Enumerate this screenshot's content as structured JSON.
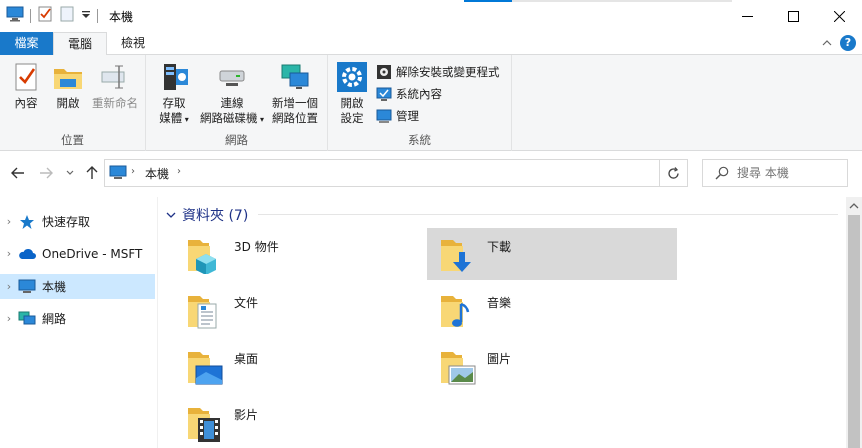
{
  "window": {
    "title": "本機"
  },
  "ribbon_tabs": {
    "file": "檔案",
    "computer": "電腦",
    "view": "檢視"
  },
  "ribbon": {
    "location": {
      "label": "位置",
      "properties": "內容",
      "open": "開啟",
      "rename": "重新命名"
    },
    "network": {
      "label": "網路",
      "access_media_1": "存取",
      "access_media_2": "媒體",
      "map_drive_1": "連線",
      "map_drive_2": "網路磁碟機",
      "add_location_1": "新增一個",
      "add_location_2": "網路位置"
    },
    "system": {
      "label": "系統",
      "open_settings_1": "開啟",
      "open_settings_2": "設定",
      "uninstall": "解除安裝或變更程式",
      "system_properties": "系統內容",
      "manage": "管理"
    }
  },
  "address": {
    "crumb": "本機",
    "search_placeholder": "搜尋 本機"
  },
  "nav": {
    "quick_access": "快速存取",
    "onedrive": "OneDrive - MSFT",
    "this_pc": "本機",
    "network": "網路"
  },
  "content": {
    "group_header": "資料夾 (7)",
    "folders": [
      {
        "name": "3D 物件",
        "icon": "3d-objects-icon"
      },
      {
        "name": "下載",
        "icon": "downloads-icon"
      },
      {
        "name": "文件",
        "icon": "documents-icon"
      },
      {
        "name": "音樂",
        "icon": "music-icon"
      },
      {
        "name": "桌面",
        "icon": "desktop-icon"
      },
      {
        "name": "圖片",
        "icon": "pictures-icon"
      },
      {
        "name": "影片",
        "icon": "videos-icon"
      }
    ]
  },
  "colors": {
    "accent": "#1979ca",
    "folder": "#f8d775",
    "selection": "#cce8ff"
  }
}
